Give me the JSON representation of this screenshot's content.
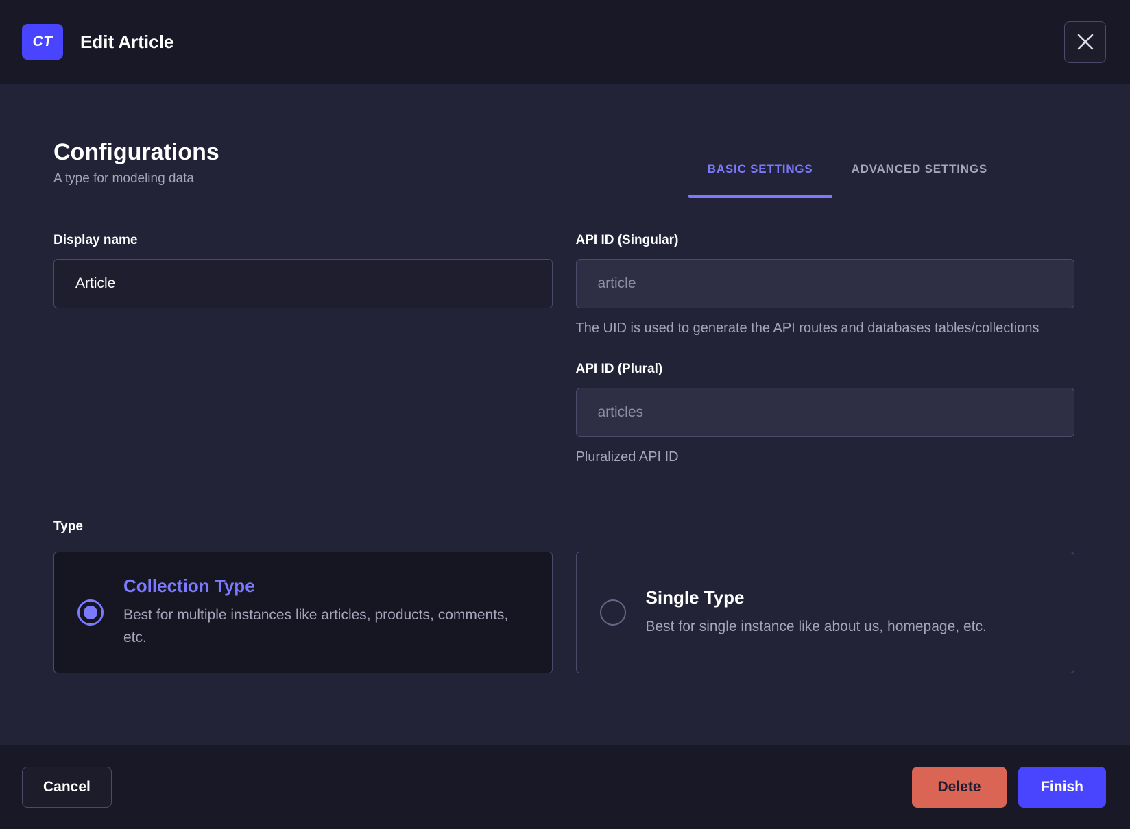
{
  "header": {
    "badge": "CT",
    "title": "Edit Article"
  },
  "intro": {
    "title": "Configurations",
    "subtitle": "A type for modeling data"
  },
  "tabs": [
    {
      "label": "BASIC SETTINGS",
      "active": true
    },
    {
      "label": "ADVANCED SETTINGS",
      "active": false
    }
  ],
  "form": {
    "display_name": {
      "label": "Display name",
      "value": "Article"
    },
    "api_id_singular": {
      "label": "API ID (Singular)",
      "value": "article",
      "helper": "The UID is used to generate the API routes and databases tables/collections"
    },
    "api_id_plural": {
      "label": "API ID (Plural)",
      "value": "articles",
      "helper": "Pluralized API ID"
    },
    "type": {
      "label": "Type",
      "options": [
        {
          "title": "Collection Type",
          "description": "Best for multiple instances like articles, products, comments, etc.",
          "selected": true
        },
        {
          "title": "Single Type",
          "description": "Best for single instance like about us, homepage, etc.",
          "selected": false
        }
      ]
    }
  },
  "footer": {
    "cancel": "Cancel",
    "delete": "Delete",
    "finish": "Finish"
  },
  "colors": {
    "primary": "#4945ff",
    "accent": "#7b79ff",
    "danger": "#db6554",
    "chrome_background": "#181826",
    "body_background": "#232337"
  }
}
